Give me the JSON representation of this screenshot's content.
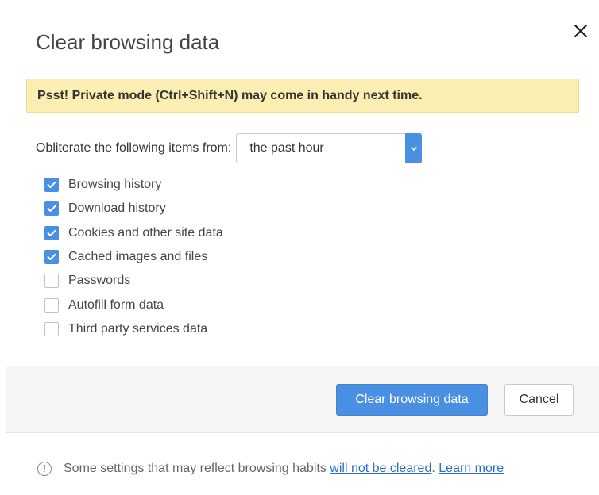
{
  "dialog": {
    "title": "Clear browsing data",
    "banner": "Psst! Private mode (Ctrl+Shift+N) may come in handy next time.",
    "range_label": "Obliterate the following items from:",
    "range_value": "the past hour",
    "items": [
      {
        "label": "Browsing history",
        "checked": true
      },
      {
        "label": "Download history",
        "checked": true
      },
      {
        "label": "Cookies and other site data",
        "checked": true
      },
      {
        "label": "Cached images and files",
        "checked": true
      },
      {
        "label": "Passwords",
        "checked": false
      },
      {
        "label": "Autofill form data",
        "checked": false
      },
      {
        "label": "Third party services data",
        "checked": false
      }
    ],
    "clear_button": "Clear browsing data",
    "cancel_button": "Cancel",
    "note_text": "Some settings that may reflect browsing habits",
    "note_link": "will not be cleared",
    "note_period": ".",
    "learn_more": "Learn more"
  },
  "colors": {
    "accent": "#4a90e2",
    "banner_bg": "#fbeeb3",
    "footer_bg": "#f6f6f6",
    "link": "#2a6fc9"
  },
  "icons": {
    "close": "close-icon",
    "dropdown": "chevron-down-icon",
    "checkbox": "checkmark-icon",
    "info": "info-icon"
  }
}
